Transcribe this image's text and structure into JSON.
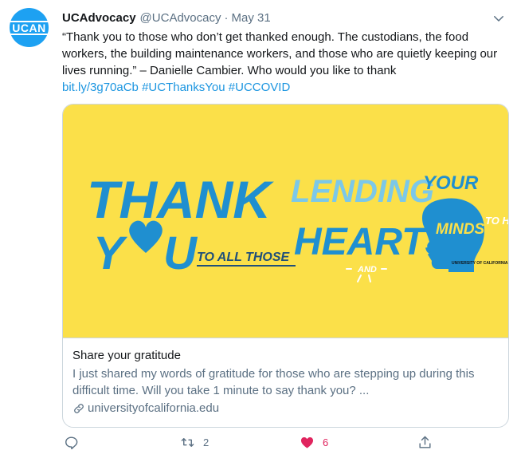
{
  "author": {
    "avatar_text": "UCAN",
    "name": "UCAdvocacy",
    "handle": "@UCAdvocacy",
    "separator": "·",
    "date": "May 31"
  },
  "tweet": {
    "text": "“Thank you to those who don’t get thanked enough. The custodians, the food workers, the building maintenance workers, and those who are quietly keeping our lives running.” – Danielle Cambier. Who would you like to thank",
    "links": [
      "bit.ly/3g70aCb",
      "#UCThanksYou",
      "#UCCOVID"
    ]
  },
  "card": {
    "image_text": {
      "thank": "THANK",
      "you": "YOU",
      "to_all_those": "TO ALL THOSE",
      "lending": "LENDING",
      "your": "YOUR",
      "hearts": "HEARTS",
      "and": "AND",
      "minds": "MINDS",
      "to_help": "TO HELP",
      "logo": "UNIVERSITY OF CALIFORNIA"
    },
    "title": "Share your gratitude",
    "description": "I just shared my words of gratitude for those who are stepping up during this difficult time. Will you take 1 minute to say thank you? ...",
    "url": "universityofcalifornia.edu"
  },
  "actions": {
    "reply_count": "",
    "retweet_count": "2",
    "like_count": "6",
    "share_count": ""
  },
  "colors": {
    "accent": "#1da1f2",
    "link": "#1b95e0",
    "like": "#e0245e",
    "card_image_bg": "#fbe049",
    "illustration_blue": "#1f8fd0",
    "illustration_lightblue": "#7cc8e8"
  },
  "icons": [
    "chevron-down-icon",
    "link-icon",
    "reply-icon",
    "retweet-icon",
    "heart-filled-icon",
    "share-icon"
  ]
}
